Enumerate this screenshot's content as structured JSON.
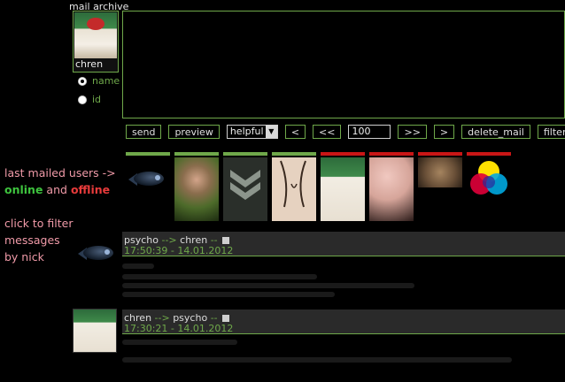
{
  "header": {
    "title": "mail archive"
  },
  "profile": {
    "username": "chren"
  },
  "filter_options": [
    {
      "label": "name",
      "checked": true
    },
    {
      "label": "id",
      "checked": false
    }
  ],
  "toolbar": {
    "send": "send",
    "preview": "preview",
    "sort_select": "helpful",
    "first": "<",
    "prev_page": "<<",
    "count": "100",
    "next_page": ">>",
    "last": ">",
    "delete": "delete_mail",
    "filter": "filter_by"
  },
  "sidebar": {
    "line1": "last mailed users ->",
    "online": "online",
    "and": "and",
    "offline": "offline",
    "hint1": "click to filter",
    "hint2": "messages",
    "hint3": "by nick"
  },
  "colors": {
    "accent": "#6fa84a",
    "online": "#3ec33e",
    "offline": "#e83b3b",
    "pink": "#f09aa8"
  },
  "recent_users": [
    {
      "icon": "fish-avatar-icon",
      "status": "online"
    },
    {
      "icon": "warrior-avatar-icon",
      "status": "online"
    },
    {
      "icon": "chevron-rank-avatar-icon",
      "status": "online"
    },
    {
      "icon": "sketch-avatar-icon",
      "status": "online"
    },
    {
      "icon": "jar-avatar-icon",
      "status": "offline"
    },
    {
      "icon": "face-avatar-icon",
      "status": "offline"
    },
    {
      "icon": "wolf-avatar-icon",
      "status": "offline"
    },
    {
      "icon": "rgb-circles-avatar-icon",
      "status": "offline"
    }
  ],
  "messages": [
    {
      "from": "psycho",
      "arrow": "-->",
      "to": "chren",
      "dash": "--",
      "time": "17:50:39 - 14.01.2012"
    },
    {
      "from": "chren",
      "arrow": "-->",
      "to": "psycho",
      "dash": "--",
      "time": "17:30:21 - 14.01.2012"
    }
  ]
}
